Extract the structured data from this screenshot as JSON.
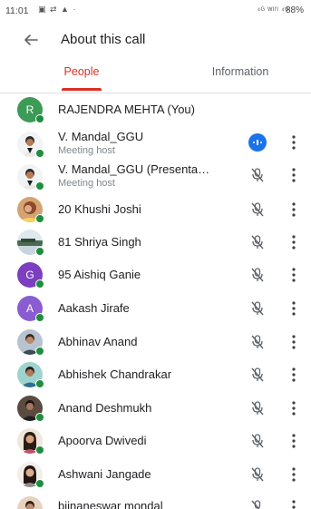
{
  "status_bar": {
    "time": "11:01",
    "left_icons": "▣ ⇄ ▲ ·",
    "right_icons": "⁴ᴳ ᵂᴵᶠᴵ ⁴ᴳ",
    "battery": "88%"
  },
  "header": {
    "back_icon": "arrow-left-icon",
    "title": "About this call"
  },
  "tabs": [
    {
      "label": "People",
      "active": true
    },
    {
      "label": "Information",
      "active": false
    }
  ],
  "colors": {
    "accent": "#d93025",
    "online": "#1e8e3e",
    "speaking": "#1a73e8",
    "muted_icon": "#5f6368"
  },
  "participants": [
    {
      "name": "RAJENDRA MEHTA (You)",
      "initial": "R",
      "avatar_color": "#3c9b56",
      "mic": "none"
    },
    {
      "name": "V. Mandal_GGU",
      "sub": "Meeting host",
      "avatar": "photo",
      "mic": "speaking"
    },
    {
      "name": "V. Mandal_GGU (Presenta…",
      "sub": "Meeting host",
      "avatar": "photo",
      "mic": "muted"
    },
    {
      "name": "20 Khushi Joshi",
      "avatar": "photo",
      "mic": "muted"
    },
    {
      "name": "81 Shriya Singh",
      "avatar": "photo",
      "mic": "muted"
    },
    {
      "name": "95 Aishiq Ganie",
      "initial": "G",
      "avatar_color": "#7b3fbf",
      "mic": "muted"
    },
    {
      "name": "Aakash Jirafe",
      "initial": "A",
      "avatar_color": "#8a5cd1",
      "mic": "muted"
    },
    {
      "name": "Abhinav Anand",
      "avatar": "photo",
      "mic": "muted"
    },
    {
      "name": "Abhishek Chandrakar",
      "avatar": "photo",
      "mic": "muted"
    },
    {
      "name": "Anand Deshmukh",
      "avatar": "photo",
      "mic": "muted"
    },
    {
      "name": "Apoorva Dwivedi",
      "avatar": "photo",
      "mic": "muted"
    },
    {
      "name": "Ashwani Jangade",
      "avatar": "photo",
      "mic": "muted"
    },
    {
      "name": "bijnaneswar mondal",
      "avatar": "photo",
      "mic": "muted"
    }
  ]
}
